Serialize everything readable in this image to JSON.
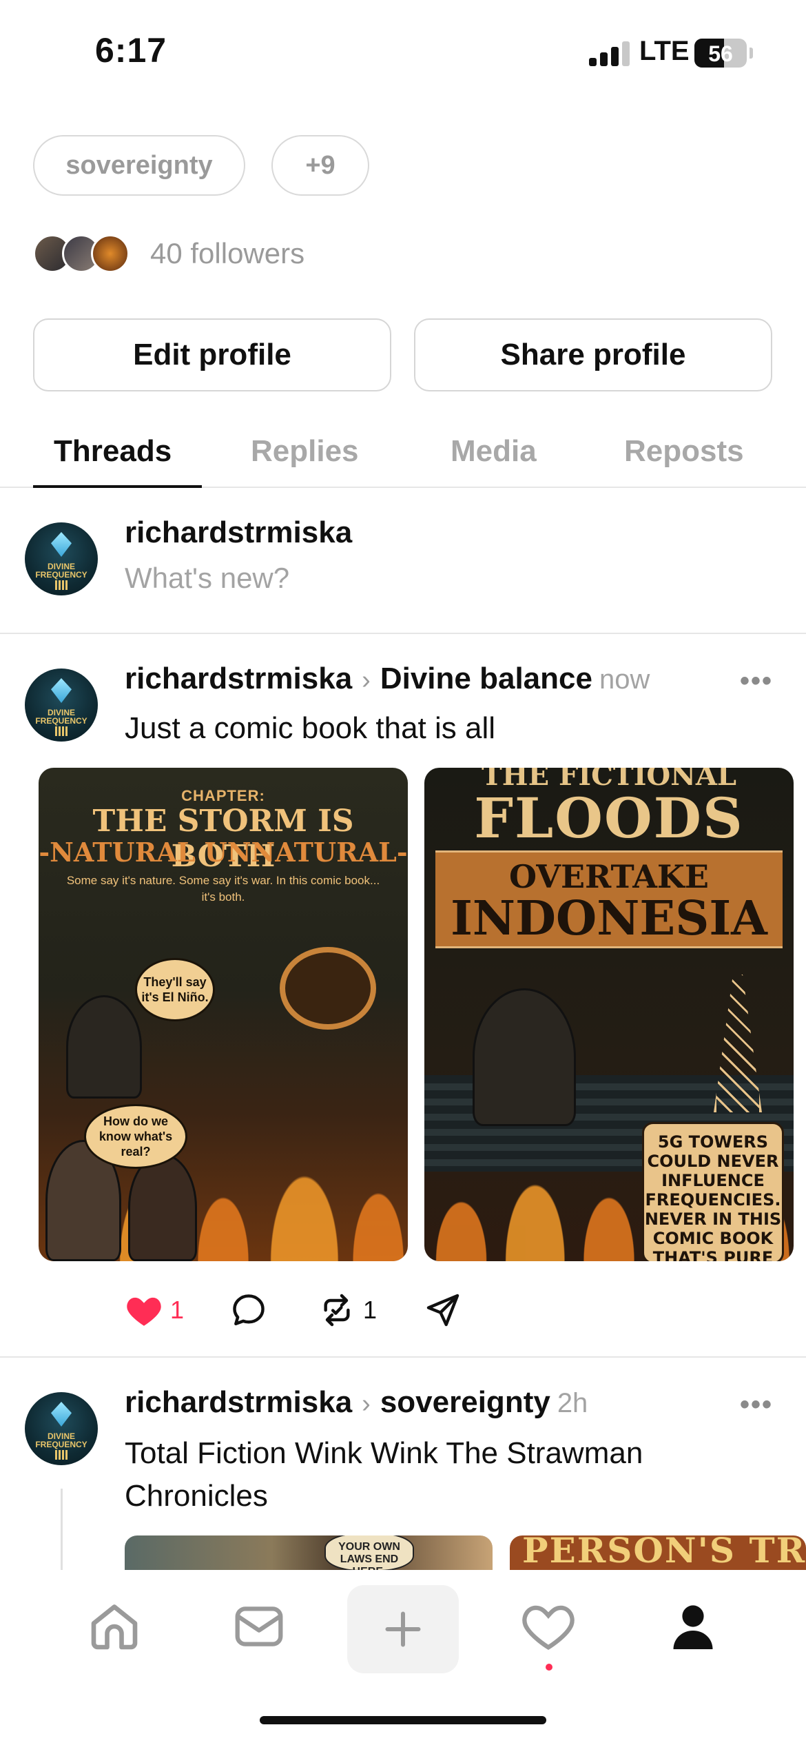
{
  "status_bar": {
    "time": "6:17",
    "network": "LTE",
    "battery": "56",
    "battery_level_percent": 56
  },
  "profile": {
    "tags": [
      "sovereignty",
      "+9"
    ],
    "followers_text": "40 followers",
    "edit_button": "Edit profile",
    "share_button": "Share profile"
  },
  "tabs": [
    {
      "label": "Threads",
      "active": true
    },
    {
      "label": "Replies",
      "active": false
    },
    {
      "label": "Media",
      "active": false
    },
    {
      "label": "Reposts",
      "active": false
    }
  ],
  "compose": {
    "username": "richardstrmiska",
    "placeholder": "What's new?"
  },
  "avatar_text": "DIVINE FREQUENCY",
  "posts": [
    {
      "username": "richardstrmiska",
      "topic": "Divine balance",
      "time": "now",
      "text": "Just a comic book that is all",
      "images": [
        {
          "kicker": "CHAPTER:",
          "title": "THE STORM IS BOTH",
          "subtitle": "-NATURAL UNNATURAL-",
          "tagline": "Some say it's nature. Some say it's war. In this comic book... it's both.",
          "bubble1": "They'll say it's El Niño.",
          "bubble2": "How do we know what's real?"
        },
        {
          "title_top": "THE FICTIONAL",
          "title_main": "FLOODS",
          "band_top": "OVERTAKE",
          "band_main": "INDONESIA",
          "caption": "5G TOWERS COULD NEVER INFLUENCE FREQUENCIES. NEVER IN THIS COMIC BOOK THAT'S PURE"
        }
      ],
      "likes": "1",
      "reposts": "1",
      "liked": true
    },
    {
      "username": "richardstrmiska",
      "topic": "sovereignty",
      "time": "2h",
      "text": "Total Fiction Wink Wink The Strawman Chronicles",
      "peek_bubble": "YOUR OWN LAWS END HERE.",
      "peek_title": "PERSON'S TRI"
    }
  ],
  "tab_bar": {
    "icons": [
      "home-icon",
      "inbox-icon",
      "plus-icon",
      "heart-icon",
      "profile-icon"
    ],
    "activity_badge_color": "#ff2d55"
  },
  "colors": {
    "accent_like": "#ff2d55",
    "muted_text": "#9a9a9a",
    "divider": "#e6e6e6"
  }
}
